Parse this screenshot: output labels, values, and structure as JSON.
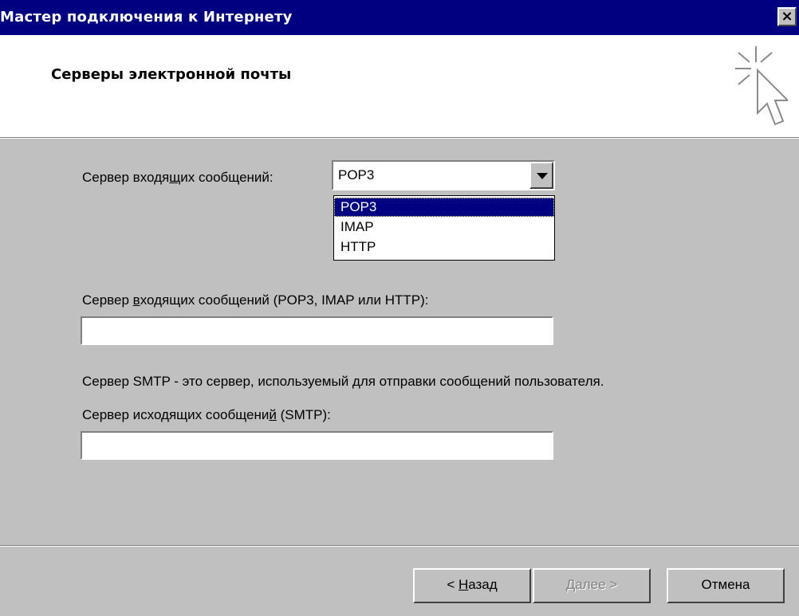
{
  "window": {
    "title": "Мастер подключения к Интернету",
    "close_glyph": "×"
  },
  "header": {
    "title": "Серверы электронной почты",
    "icon": "wizard-sparkle-cursor-icon"
  },
  "incoming_type": {
    "label_before": "Сервер входя",
    "label_underlined": "щ",
    "label_after": "их сообщений:",
    "selected": "POP3",
    "options": [
      "POP3",
      "IMAP",
      "HTTP"
    ]
  },
  "incoming_server": {
    "label_before": "Сервер ",
    "label_underlined": "в",
    "label_after": "ходящих сообщений (POP3, IMAP или HTTP):",
    "value": ""
  },
  "smtp_note": "Сервер SMTP - это сервер, используемый для отправки сообщений  пользователя.",
  "outgoing_server": {
    "label_before": "Сервер исходящих сообщени",
    "label_underlined": "й",
    "label_after": " (SMTP):",
    "value": ""
  },
  "buttons": {
    "back_prefix": "< ",
    "back_underlined": "Н",
    "back_rest": "азад",
    "next": "Далее >",
    "cancel": "Отмена"
  },
  "colors": {
    "titlebar": "#000080",
    "dialog": "#c0c0c0",
    "selection": "#000080"
  }
}
